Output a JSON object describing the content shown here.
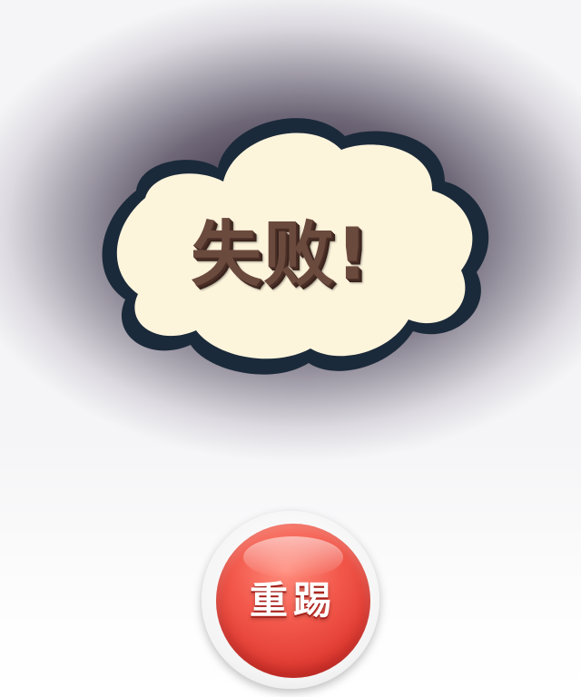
{
  "result_popup": {
    "title": "失败!",
    "retry_label": "重踢"
  },
  "colors": {
    "cloud_fill": "#fdf4dc",
    "cloud_outline": "#1b2a3a",
    "title_text": "#6b4a3e",
    "button_red": "#e03a31",
    "backdrop_dark": "#3f3648"
  }
}
